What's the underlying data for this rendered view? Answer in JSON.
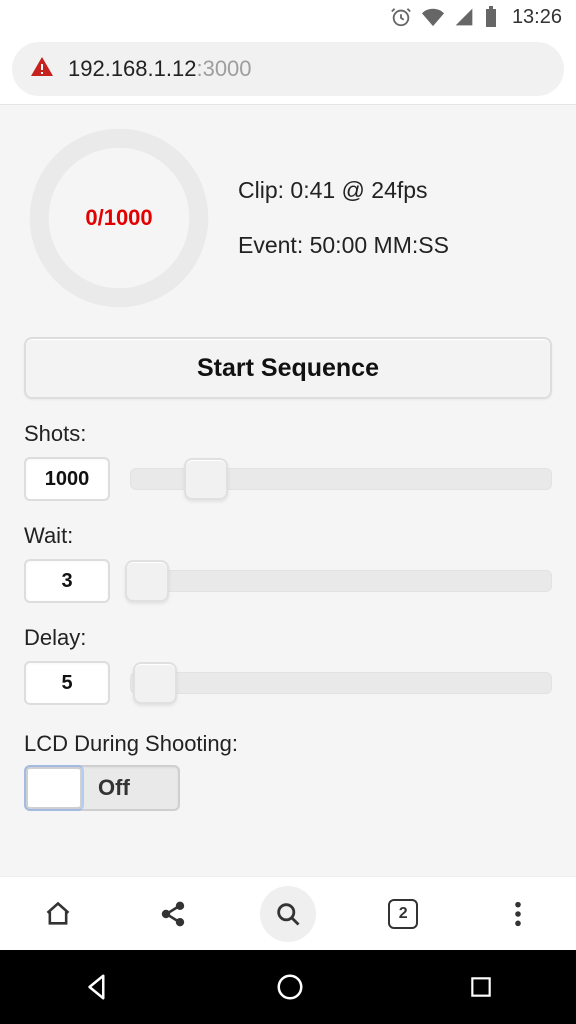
{
  "status": {
    "time": "13:26"
  },
  "url": {
    "host": "192.168.1.12",
    "port": ":3000"
  },
  "counter": {
    "current": 0,
    "total": 1000
  },
  "clip": {
    "text": "Clip: 0:41 @ 24fps"
  },
  "event": {
    "text": "Event: 50:00 MM:SS"
  },
  "startLabel": "Start Sequence",
  "controls": {
    "shots": {
      "label": "Shots:",
      "value": "1000",
      "pct": 18
    },
    "wait": {
      "label": "Wait:",
      "value": "3",
      "pct": 4
    },
    "delay": {
      "label": "Delay:",
      "value": "5",
      "pct": 6
    }
  },
  "lcd": {
    "label": "LCD During Shooting:",
    "state": "Off"
  },
  "browser": {
    "tabCount": "2"
  }
}
